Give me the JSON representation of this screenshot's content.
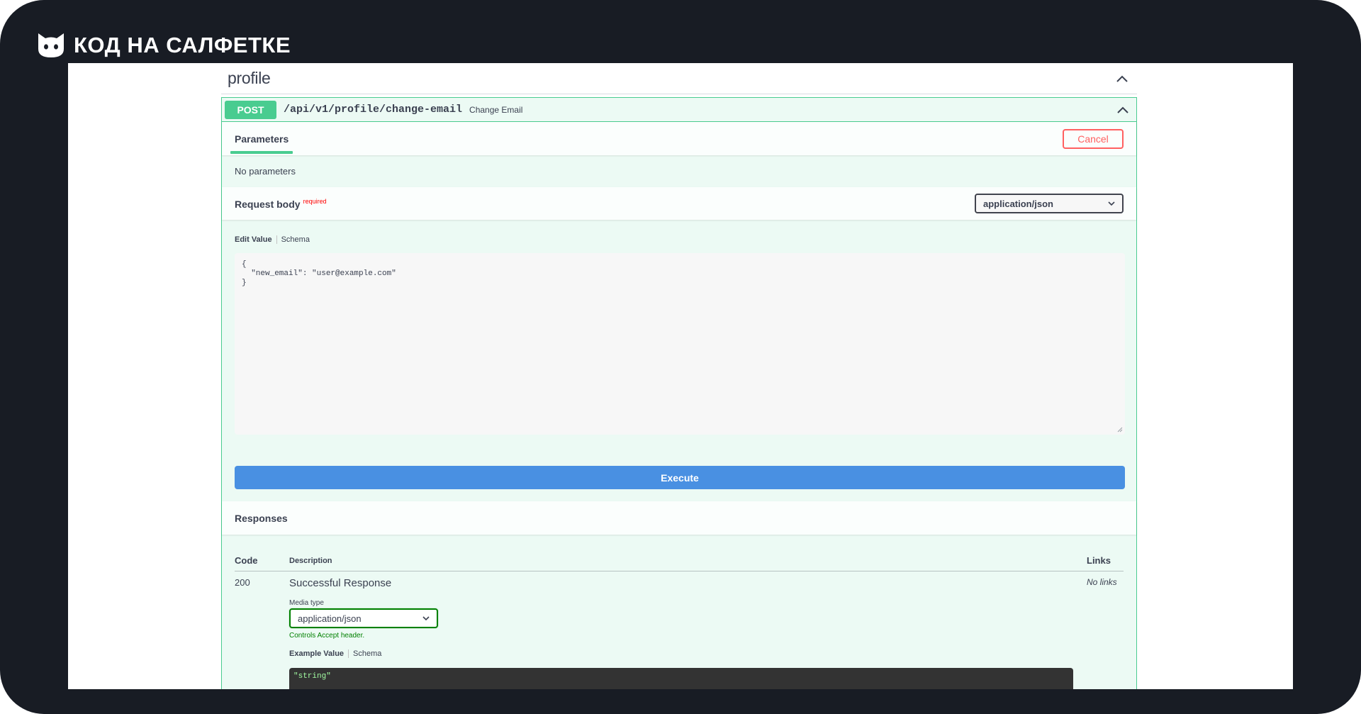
{
  "brand": {
    "name": "КОД НА САЛФЕТКЕ",
    "logo_icon": "cat-head-icon"
  },
  "tag": {
    "title": "profile",
    "toggle_icon": "chevron-up-icon"
  },
  "operation": {
    "method": "POST",
    "path": "/api/v1/profile/change-email",
    "summary": "Change Email",
    "colors": {
      "post": "#49cc90",
      "execute": "#4990e2",
      "cancel": "#ff6060"
    }
  },
  "parameters": {
    "tab_label": "Parameters",
    "cancel_label": "Cancel",
    "empty_text": "No parameters"
  },
  "request_body": {
    "title": "Request body",
    "required_label": "required",
    "content_type": "application/json",
    "edit_value_tab": "Edit Value",
    "schema_tab": "Schema",
    "value": "{\n  \"new_email\": \"user@example.com\"\n}"
  },
  "execute_label": "Execute",
  "responses": {
    "title": "Responses",
    "columns": {
      "code": "Code",
      "description": "Description",
      "links": "Links"
    },
    "rows": [
      {
        "code": "200",
        "description": "Successful Response",
        "links": "No links",
        "media_type_label": "Media type",
        "media_type": "application/json",
        "controls_accept": "Controls Accept header.",
        "example_value_tab": "Example Value",
        "schema_tab": "Schema",
        "example": "\"string\""
      }
    ]
  }
}
